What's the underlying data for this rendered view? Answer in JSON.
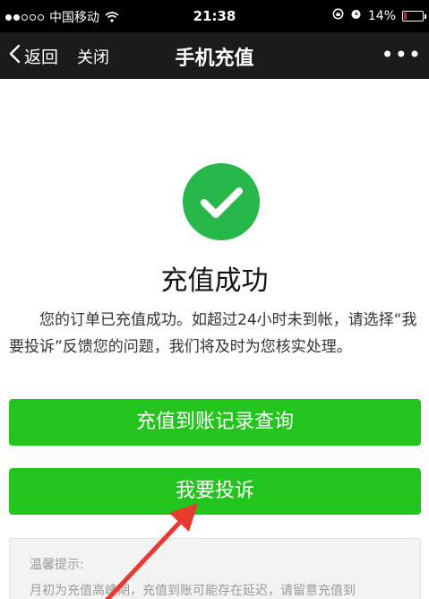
{
  "status_bar": {
    "carrier": "中国移动",
    "time": "21:38",
    "battery_percent": "14%",
    "battery_level": 0.14
  },
  "nav": {
    "back_label": "返回",
    "close_label": "关闭",
    "title": "手机充值",
    "more_label": "•••"
  },
  "result": {
    "title": "充值成功",
    "description": "您的订单已充值成功。如超过24小时未到帐，请选择“我要投诉”反馈您的问题，我们将及时为您核实处理。"
  },
  "buttons": {
    "records_label": "充值到账记录查询",
    "complaint_label": "我要投诉"
  },
  "tips": {
    "title": "温馨提示:",
    "body": "月初为充值高峰期，充值到账可能存在延迟，请留意充值到"
  },
  "colors": {
    "accent_green": "#22c41d",
    "success_icon_green": "#28b74a",
    "annotation_red": "#e83a2d",
    "navbar_bg": "#1b1b1b"
  }
}
